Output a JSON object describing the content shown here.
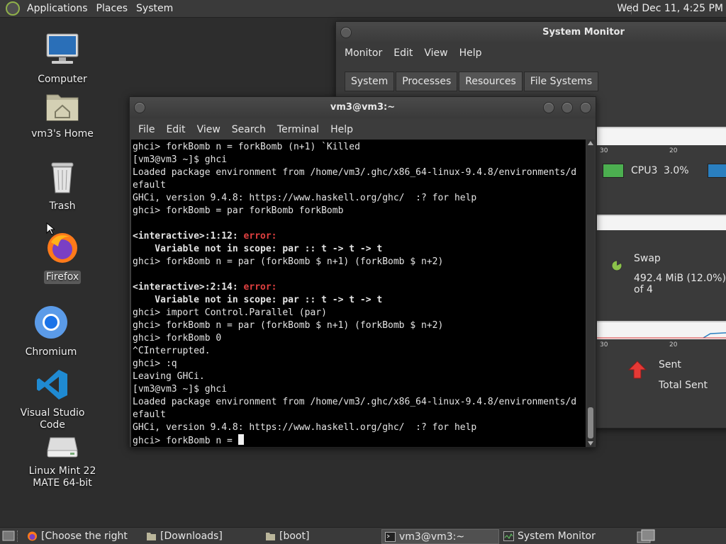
{
  "top_panel": {
    "menus": [
      "Applications",
      "Places",
      "System"
    ],
    "clock": "Wed Dec 11,  4:25 PM"
  },
  "desktop": {
    "icons": [
      {
        "label": "Computer",
        "icon": "computer-icon"
      },
      {
        "label": "vm3's Home",
        "icon": "home-folder-icon"
      },
      {
        "label": "Trash",
        "icon": "trash-icon"
      },
      {
        "label": "Firefox",
        "icon": "firefox-icon"
      },
      {
        "label": "Chromium",
        "icon": "chromium-icon"
      },
      {
        "label": "Visual Studio Code",
        "icon": "vscode-icon"
      },
      {
        "label": "Linux Mint 22 MATE 64-bit",
        "icon": "disk-drive-icon"
      }
    ]
  },
  "system_monitor": {
    "title": "System Monitor",
    "menu": [
      "Monitor",
      "Edit",
      "View",
      "Help"
    ],
    "tabs": [
      "System",
      "Processes",
      "Resources",
      "File Systems"
    ],
    "active_tab": "Resources",
    "ticks": [
      "30",
      "20"
    ],
    "cpu_label": "CPU3",
    "cpu_value": "3.0%",
    "swap_label": "Swap",
    "swap_value": "492.4 MiB (12.0%) of 4",
    "sent_label": "Sent",
    "total_sent_label": "Total Sent",
    "colors": {
      "cpu3": "#4caf50",
      "cpu4": "#2a7fc0"
    }
  },
  "terminal": {
    "title": "vm3@vm3:~",
    "menu": [
      "File",
      "Edit",
      "View",
      "Search",
      "Terminal",
      "Help"
    ],
    "lines": [
      "ghci> forkBomb n = forkBomb (n+1) `Killed",
      "[vm3@vm3 ~]$ ghci",
      "Loaded package environment from /home/vm3/.ghc/x86_64-linux-9.4.8/environments/d",
      "efault",
      "GHCi, version 9.4.8: https://www.haskell.org/ghc/  :? for help",
      "ghci> forkBomb = par forkBomb forkBomb",
      "",
      "<interactive>:1:12: ",
      "    Variable not in scope: par :: t -> t -> t",
      "ghci> forkBomb n = par (forkBomb $ n+1) (forkBomb $ n+2)",
      "",
      "<interactive>:2:14: ",
      "    Variable not in scope: par :: t -> t -> t",
      "ghci> import Control.Parallel (par)",
      "ghci> forkBomb n = par (forkBomb $ n+1) (forkBomb $ n+2)",
      "ghci> forkBomb 0",
      "^CInterrupted.",
      "ghci> :q",
      "Leaving GHCi.",
      "[vm3@vm3 ~]$ ghci",
      "Loaded package environment from /home/vm3/.ghc/x86_64-linux-9.4.8/environments/d",
      "efault",
      "GHCi, version 9.4.8: https://www.haskell.org/ghc/  :? for help",
      "ghci> forkBomb n = "
    ],
    "error_word": "error:"
  },
  "taskbar": {
    "tasks": [
      {
        "label": "[Choose the right e...",
        "icon": "firefox-icon"
      },
      {
        "label": "[Downloads]",
        "icon": "folder-icon"
      },
      {
        "label": "[boot]",
        "icon": "folder-icon"
      },
      {
        "label": "vm3@vm3:~",
        "icon": "terminal-icon"
      },
      {
        "label": "System Monitor",
        "icon": "system-monitor-icon"
      }
    ]
  }
}
